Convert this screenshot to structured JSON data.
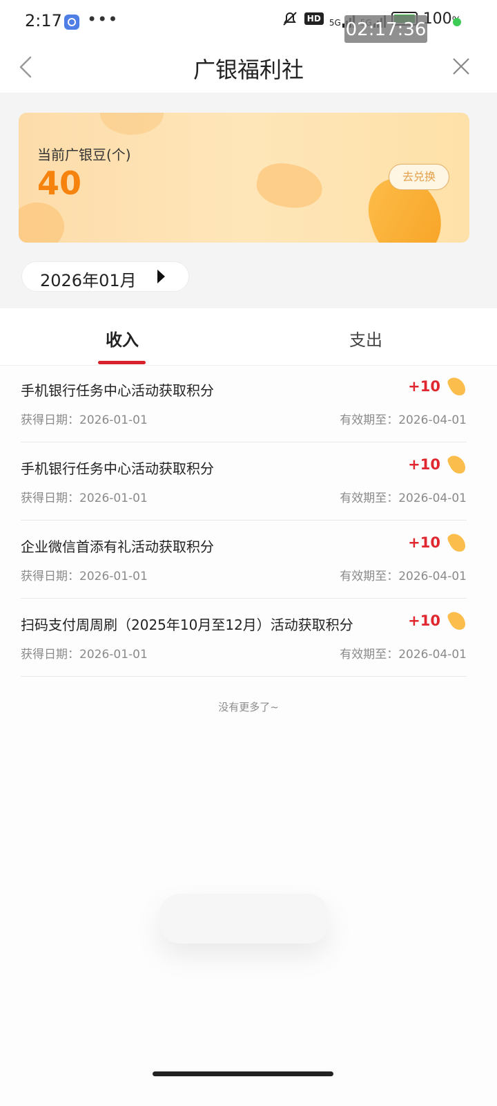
{
  "status_bar": {
    "time": "2:17",
    "dots": "•••",
    "hd": "HD",
    "signal1": "5G",
    "signal2": "5G",
    "battery": "100",
    "battery_unit": "%",
    "clock_overlay": "02:17:36"
  },
  "nav": {
    "title": "广银福利社"
  },
  "balance_card": {
    "label": "当前广银豆(个)",
    "value": "40",
    "exchange_label": "去兑换"
  },
  "month_selector": {
    "value": "2026年01月"
  },
  "tabs": [
    {
      "label": "收入",
      "active": true
    },
    {
      "label": "支出",
      "active": false
    }
  ],
  "records": [
    {
      "title": "手机银行任务中心活动获取积分",
      "amount": "+10",
      "obtain_date": "获得日期：2026-01-01",
      "expire_date": "有效期至：2026-04-01"
    },
    {
      "title": "手机银行任务中心活动获取积分",
      "amount": "+10",
      "obtain_date": "获得日期：2026-01-01",
      "expire_date": "有效期至：2026-04-01"
    },
    {
      "title": "企业微信首添有礼活动获取积分",
      "amount": "+10",
      "obtain_date": "获得日期：2026-01-01",
      "expire_date": "有效期至：2026-04-01"
    },
    {
      "title": "扫码支付周周刷（2025年10月至12月）活动获取积分",
      "amount": "+10",
      "obtain_date": "获得日期：2026-01-01",
      "expire_date": "有效期至：2026-04-01"
    }
  ],
  "list_footer": "没有更多了~",
  "icons": {
    "back": "chevron-left-icon",
    "close": "close-icon",
    "bean": "bean-icon",
    "month_arrow": "triangle-right-icon",
    "mute": "bell-off-icon"
  },
  "colors": {
    "accent_red": "#d8222e",
    "amount_red": "#e0272f",
    "balance_orange": "#f5830d",
    "card_gradient_start": "#fddcaa",
    "card_gradient_end": "#fee1a8"
  }
}
